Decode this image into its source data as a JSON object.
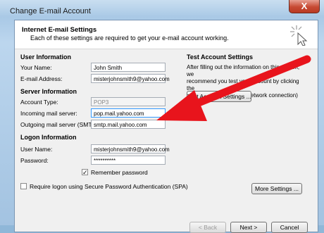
{
  "window": {
    "title": "Change E-mail Account",
    "close_glyph": "X"
  },
  "header": {
    "title": "Internet E-mail Settings",
    "subtitle": "Each of these settings are required to get your e-mail account working."
  },
  "user_info": {
    "heading": "User Information",
    "name_label": "Your Name:",
    "name_value": "John Smith",
    "email_label": "E-mail Address:",
    "email_value": "misterjohnsmith9@yahoo.com"
  },
  "server_info": {
    "heading": "Server Information",
    "type_label": "Account Type:",
    "type_value": "POP3",
    "incoming_label": "Incoming mail server:",
    "incoming_value": "pop.mail.yahoo.com",
    "outgoing_label": "Outgoing mail server (SMTP):",
    "outgoing_value": "smtp.mail.yahoo.com"
  },
  "logon_info": {
    "heading": "Logon Information",
    "user_label": "User Name:",
    "user_value": "misterjohnsmith9@yahoo.com",
    "password_label": "Password:",
    "password_value": "**********",
    "remember_label": "Remember password",
    "remember_checked": "✓",
    "spa_label": "Require logon using Secure Password Authentication (SPA)"
  },
  "test": {
    "heading": "Test Account Settings",
    "desc_line1": "After filling out the information on this screen, we",
    "desc_line2": "recommend you test your account by clicking the",
    "desc_line3": "button below. (Requires network connection)",
    "button": "Test Account Settings ..."
  },
  "buttons": {
    "more": "More Settings ...",
    "back": "< Back",
    "next": "Next >",
    "cancel": "Cancel"
  },
  "colors": {
    "arrow": "#e8141c"
  }
}
